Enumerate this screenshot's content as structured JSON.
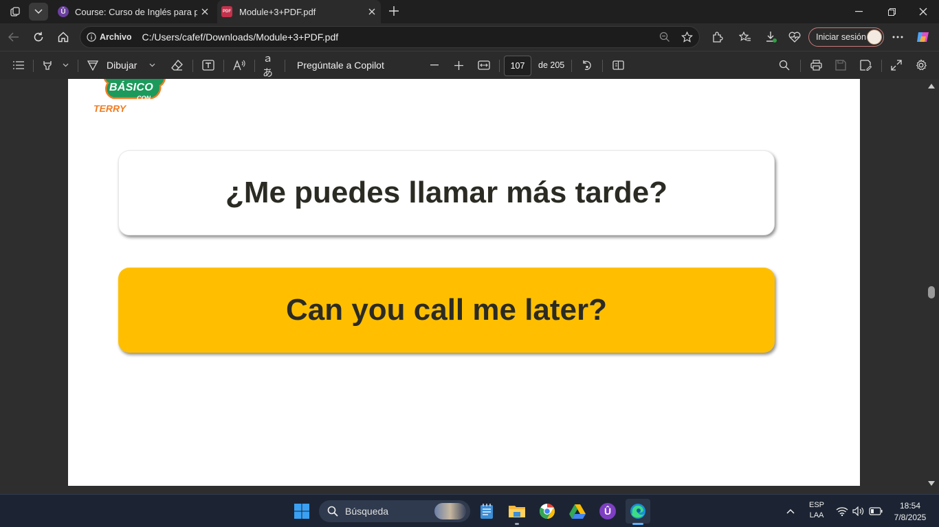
{
  "tabs": [
    {
      "title": "Course: Curso de Inglés para prin",
      "icon": "udemy-icon"
    },
    {
      "title": "Module+3+PDF.pdf",
      "icon": "pdf-icon"
    }
  ],
  "address": {
    "site_label": "Archivo",
    "url": "C:/Users/cafef/Downloads/Module+3+PDF.pdf"
  },
  "profile": {
    "signin_label": "Iniciar sesión"
  },
  "pdf_toolbar": {
    "draw_label": "Dibujar",
    "ask_copilot_label": "Pregúntale a Copilot",
    "current_page": "107",
    "page_total_label": "de 205"
  },
  "document": {
    "logo_text": {
      "top": "BÁSICO",
      "small": "CON",
      "bottom": "TERRY"
    },
    "question_es": "¿Me puedes llamar más tarde?",
    "question_en": "Can you call me later?",
    "colors": {
      "accent_card": "#ffbf00",
      "logo_green": "#1b9a5b",
      "logo_orange": "#f07c23"
    }
  },
  "taskbar": {
    "search_placeholder": "Búsqueda",
    "language": {
      "lang": "ESP",
      "layout": "LAA"
    },
    "time": "18:54",
    "date": "7/8/2025"
  }
}
